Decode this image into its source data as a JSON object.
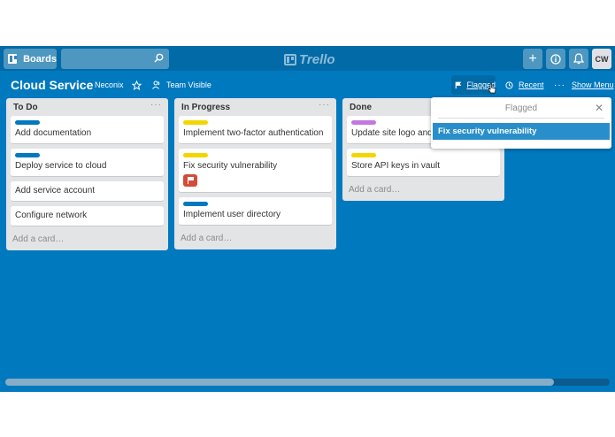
{
  "header": {
    "boards_label": "Boards",
    "logo_text": "Trello",
    "add_symbol": "+",
    "info_symbol": "i",
    "avatar_initials": "CW"
  },
  "board": {
    "title": "Cloud Service",
    "team": "Neconix",
    "visibility": "Team Visible",
    "flagged_label": "Flagged",
    "recent_label": "Recent",
    "show_menu_label": "Show Menu"
  },
  "lists": [
    {
      "title": "To Do",
      "cards": [
        {
          "title": "Add documentation",
          "label_color": "#0079bf"
        },
        {
          "title": "Deploy service to cloud",
          "label_color": "#0079bf"
        },
        {
          "title": "Add service account",
          "label_color": ""
        },
        {
          "title": "Configure network",
          "label_color": ""
        }
      ],
      "add_card": "Add a card…"
    },
    {
      "title": "In Progress",
      "cards": [
        {
          "title": "Implement two-factor authentication",
          "label_color": "#f2d600"
        },
        {
          "title": "Fix security vulnerability",
          "label_color": "#f2d600",
          "flagged": true
        },
        {
          "title": "Implement user directory",
          "label_color": "#0079bf"
        }
      ],
      "add_card": "Add a card…"
    },
    {
      "title": "Done",
      "cards": [
        {
          "title": "Update site logo and",
          "label_color": "#c377e0"
        },
        {
          "title": "Store API keys in vault",
          "label_color": "#f2d600"
        }
      ],
      "add_card": "Add a card…"
    }
  ],
  "flagged_popover": {
    "title": "Flagged",
    "items": [
      "Fix security vulnerability"
    ]
  },
  "colors": {
    "board_bg": "#0079bf",
    "header_bg": "#026aa7",
    "list_bg": "#e2e4e6",
    "flag_badge": "#d04d3a",
    "highlight": "#298fca"
  },
  "icons": [
    "board-icon",
    "search-icon",
    "trello-logo-icon",
    "plus-icon",
    "info-icon",
    "bell-icon",
    "star-icon",
    "team-icon",
    "flag-icon",
    "clock-icon",
    "ellipsis-icon",
    "close-icon"
  ]
}
